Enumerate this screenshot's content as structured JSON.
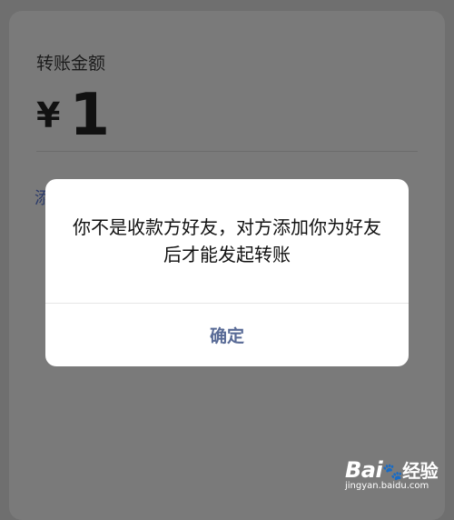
{
  "transfer": {
    "amount_label": "转账金额",
    "currency_symbol": "¥",
    "amount_value": "1",
    "note_partial": "添"
  },
  "dialog": {
    "message": "你不是收款方好友，对方添加你为好友后才能发起转账",
    "confirm_label": "确定"
  },
  "watermark": {
    "brand_prefix": "Bai",
    "brand_suffix": "经验",
    "url": "jingyan.baidu.com"
  },
  "colors": {
    "overlay": "#6f6f6f",
    "dialog_bg": "#ffffff",
    "confirm_text": "#586a96"
  }
}
